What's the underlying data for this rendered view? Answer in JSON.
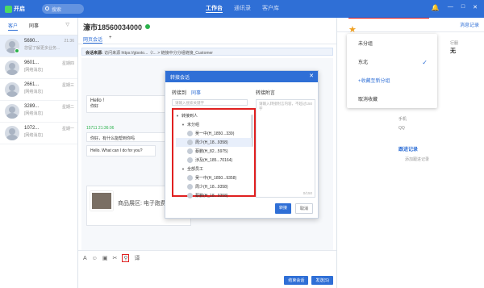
{
  "app": {
    "name": "开启",
    "search_placeholder": "搜索"
  },
  "nav": {
    "workbench": "工作台",
    "contacts": "通讯录",
    "customers": "客户库"
  },
  "left": {
    "tabs": [
      "客户",
      "同事"
    ],
    "contacts": [
      {
        "name": "5690...",
        "time": "21:36",
        "sub": "您留了解更多业务..."
      },
      {
        "name": "9601...",
        "time": "星期四",
        "sub": "[网络消息]"
      },
      {
        "name": "2661...",
        "time": "星期三",
        "sub": "[网络消息]"
      },
      {
        "name": "3289...",
        "time": "星期二",
        "sub": "[网络消息]"
      },
      {
        "name": "1072...",
        "time": "星期一",
        "sub": "[网络消息]"
      }
    ]
  },
  "mid": {
    "title": "濠市18560034000",
    "tabs": [
      "网页会话",
      "+"
    ],
    "source_label": "会话来源:",
    "source_text": "访问来源 https://gtsoto...（/... > 链接中分分组链接_Customer",
    "messages": {
      "hello1": "Hello !",
      "hello1_sub": "你好",
      "time1": "15711 21:36:06",
      "ask": "你好，有什么能帮到你吗",
      "help_en": "Hello. What can I do for you?",
      "product": "商品展区: 电子跑费"
    },
    "send_label": "结束会话",
    "send2_label": "发送(S)"
  },
  "right": {
    "tabs": [
      "消息记录"
    ],
    "fields": {
      "ranking_label": "行服",
      "ranking_value": "无",
      "phone_label": "手机",
      "qq_label": "QQ"
    },
    "followup": "跟进记录",
    "add_followup": "添加跟进记录"
  },
  "popup": {
    "items": [
      "未分组",
      "东北",
      "+收藏至新分组",
      "取消收藏"
    ],
    "selected_index": 1
  },
  "modal": {
    "title": "转接会话",
    "transfer_to": "转接到",
    "colleague_tab": "同事",
    "search_placeholder": "请输入搜索关键字",
    "attach_label": "转接附言",
    "attach_placeholder": "请输入转接附言内容，不超过150字",
    "attach_count": "0/150",
    "tree": [
      {
        "label": "转接到人",
        "level": 1
      },
      {
        "label": "未分组",
        "level": 2
      },
      {
        "label": "吴一中(H_1850...339)",
        "level": 3
      },
      {
        "label": "周少(H_18...9358)",
        "level": 3
      },
      {
        "label": "蔡鹏(H_82...5975)",
        "level": 3
      },
      {
        "label": "涉及(H_185...70164)",
        "level": 3
      },
      {
        "label": "全部员工",
        "level": 2
      },
      {
        "label": "吴一中(H_1850...9358)",
        "level": 3
      },
      {
        "label": "周少(H_18...9358)",
        "level": 3
      },
      {
        "label": "蔡鹏(H_18...9358)",
        "level": 3
      }
    ],
    "confirm": "转接",
    "cancel": "取消"
  }
}
